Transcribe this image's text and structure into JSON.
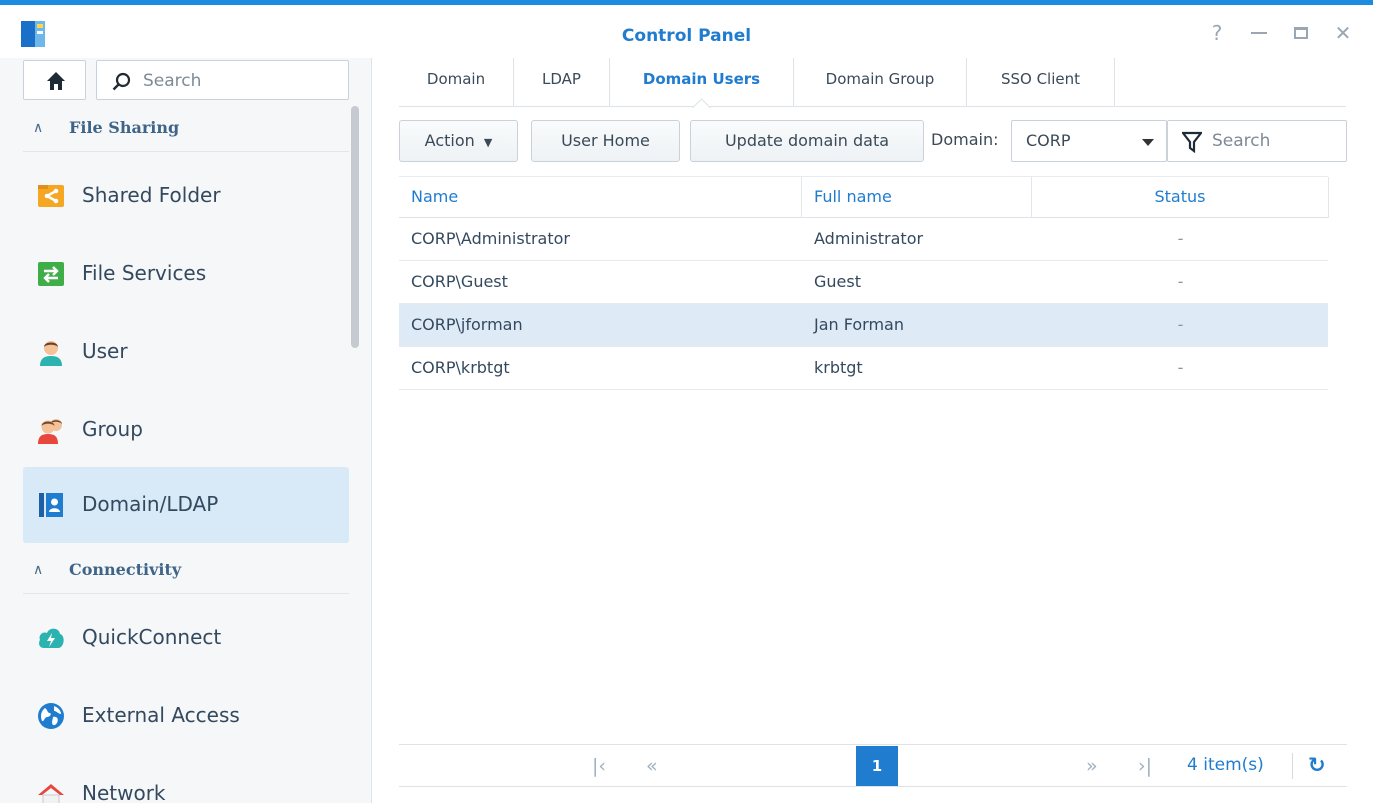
{
  "window": {
    "title": "Control Panel",
    "controls": [
      "help",
      "minimize",
      "maximize",
      "close"
    ]
  },
  "sidebar": {
    "search_placeholder": "Search",
    "sections": [
      {
        "label": "File Sharing",
        "items": [
          {
            "label": "Shared Folder",
            "icon": "shared-folder-icon"
          },
          {
            "label": "File Services",
            "icon": "file-services-icon"
          },
          {
            "label": "User",
            "icon": "user-icon"
          },
          {
            "label": "Group",
            "icon": "group-icon"
          },
          {
            "label": "Domain/LDAP",
            "icon": "domain-ldap-icon",
            "active": true
          }
        ]
      },
      {
        "label": "Connectivity",
        "items": [
          {
            "label": "QuickConnect",
            "icon": "quickconnect-icon"
          },
          {
            "label": "External Access",
            "icon": "external-access-icon"
          },
          {
            "label": "Network",
            "icon": "network-icon"
          }
        ]
      }
    ]
  },
  "tabs": [
    {
      "label": "Domain"
    },
    {
      "label": "LDAP"
    },
    {
      "label": "Domain Users",
      "active": true
    },
    {
      "label": "Domain Group"
    },
    {
      "label": "SSO Client"
    }
  ],
  "toolbar": {
    "action_label": "Action",
    "user_home_label": "User Home",
    "update_label": "Update domain data",
    "domain_label": "Domain:",
    "domain_value": "CORP",
    "filter_placeholder": "Search"
  },
  "table": {
    "columns": [
      "Name",
      "Full name",
      "Status"
    ],
    "rows": [
      {
        "name": "CORP\\Administrator",
        "full_name": "Administrator",
        "status": "-"
      },
      {
        "name": "CORP\\Guest",
        "full_name": "Guest",
        "status": "-"
      },
      {
        "name": "CORP\\jforman",
        "full_name": "Jan Forman",
        "status": "-",
        "selected": true
      },
      {
        "name": "CORP\\krbtgt",
        "full_name": "krbtgt",
        "status": "-"
      }
    ]
  },
  "pager": {
    "current_page": "1",
    "item_count": "4 item(s)"
  },
  "colors": {
    "accent": "#1f7ccf",
    "selected_row": "#deebf7",
    "active_nav": "#d8e9f8"
  }
}
